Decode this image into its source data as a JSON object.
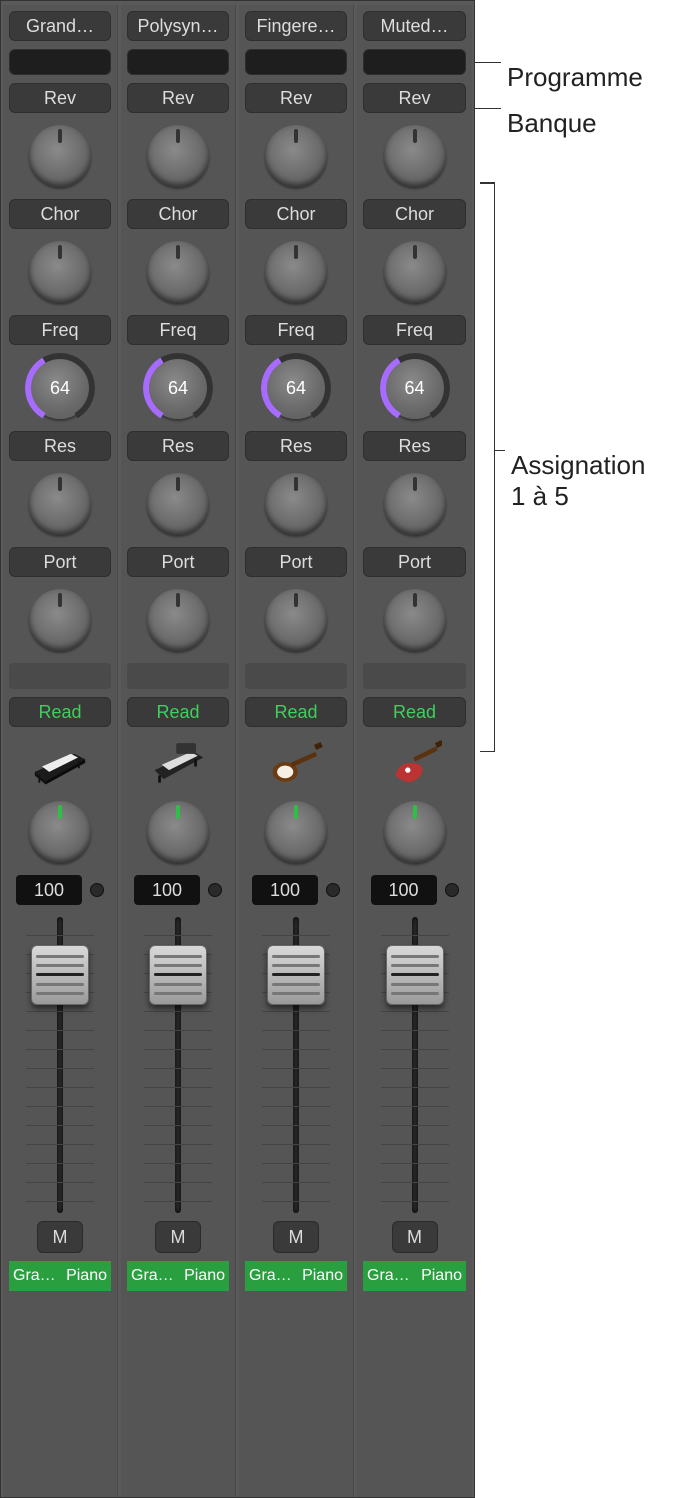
{
  "global": {
    "slot1_label": "Rev",
    "slot2_label": "Chor",
    "slot3_label": "Freq",
    "slot3_value": "64",
    "slot4_label": "Res",
    "slot5_label": "Port",
    "automation_label": "Read",
    "mute_label": "M",
    "volume_display": "100",
    "name_left": "Gra…",
    "name_right": "Piano"
  },
  "strips": [
    {
      "program": "Grand…",
      "instrument": "piano"
    },
    {
      "program": "Polysyn…",
      "instrument": "synth"
    },
    {
      "program": "Fingere…",
      "instrument": "bass"
    },
    {
      "program": "Muted…",
      "instrument": "guitar"
    }
  ],
  "annotations": {
    "program": "Programme",
    "bank": "Banque",
    "assign": "Assignation\n1 à 5"
  }
}
